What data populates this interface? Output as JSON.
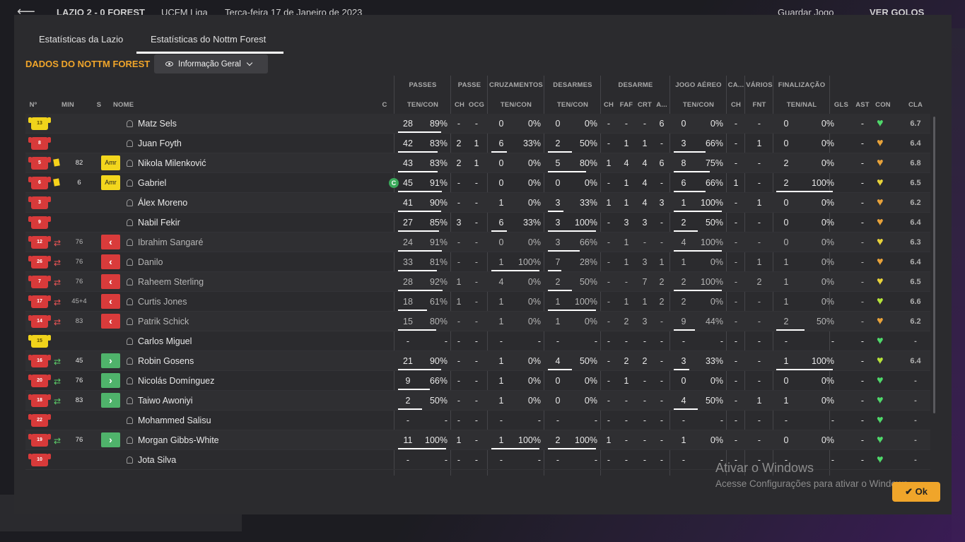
{
  "topbar": {
    "back": "⟵",
    "score": "LAZIO 2 - 0 FOREST",
    "competition": "UCFM Liga",
    "date": "Terça-feira 17 de Janeiro de 2023",
    "save": "Guardar Jogo",
    "goals": "VER GOLOS"
  },
  "tabs": [
    "Estatísticas da Lazio",
    "Estatísticas do Nottm Forest"
  ],
  "title": "DADOS DO NOTTM FOREST",
  "dropdown": "Informação Geral",
  "group_headers": [
    "PASSES",
    "PASSE",
    "CRUZAMENTOS",
    "DESARMES",
    "DESARME",
    "JOGO AÉREO",
    "CA...",
    "VÁRIOS",
    "FINALIZAÇÃO"
  ],
  "col_headers": [
    "Nº",
    "MIN",
    "S",
    "NOME",
    "C",
    "TEN/CON",
    "CH",
    "OCG",
    "TEN/CON",
    "TEN/CON",
    "CH",
    "FAF",
    "CRT",
    "A...",
    "TEN/CON",
    "CH",
    "FNT",
    "TEN/NAL",
    "GLS",
    "AST",
    "CON",
    "CLA"
  ],
  "players": [
    {
      "no": "13",
      "kit": "yel",
      "card": "",
      "sub": "",
      "min": "",
      "pos": "",
      "name": "Matz Sels",
      "cap": "",
      "pass": [
        "28",
        "89%"
      ],
      "passe": [
        "-",
        "-"
      ],
      "cruz": [
        "0",
        "0%"
      ],
      "des": [
        "0",
        "0%"
      ],
      "desarme": [
        "-",
        "-",
        "-",
        "6"
      ],
      "aereo": [
        "0",
        "0%"
      ],
      "ca": "-",
      "var": "-",
      "fin": [
        "0",
        "0%"
      ],
      "gls": "",
      "ast": "-",
      "con": "green",
      "cla": "6.7"
    },
    {
      "no": "8",
      "kit": "red",
      "card": "",
      "sub": "",
      "min": "",
      "pos": "",
      "name": "Juan Foyth",
      "cap": "",
      "pass": [
        "42",
        "83%"
      ],
      "passe": [
        "2",
        "1"
      ],
      "cruz": [
        "6",
        "33%"
      ],
      "des": [
        "2",
        "50%"
      ],
      "desarme": [
        "-",
        "1",
        "1",
        "-"
      ],
      "aereo": [
        "3",
        "66%"
      ],
      "ca": "-",
      "var": "1",
      "fin": [
        "0",
        "0%"
      ],
      "gls": "",
      "ast": "-",
      "con": "orange",
      "cla": "6.4"
    },
    {
      "no": "5",
      "kit": "red",
      "card": "y",
      "sub": "",
      "min": "82",
      "pos": "Amr",
      "name": "Nikola Milenković",
      "cap": "",
      "pass": [
        "43",
        "83%"
      ],
      "passe": [
        "2",
        "1"
      ],
      "cruz": [
        "0",
        "0%"
      ],
      "des": [
        "5",
        "80%"
      ],
      "desarme": [
        "1",
        "4",
        "4",
        "6"
      ],
      "aereo": [
        "8",
        "75%"
      ],
      "ca": "-",
      "var": "-",
      "fin": [
        "2",
        "0%"
      ],
      "gls": "",
      "ast": "-",
      "con": "orange",
      "cla": "6.8"
    },
    {
      "no": "6",
      "kit": "red",
      "card": "y",
      "sub": "",
      "min": "6",
      "pos": "Amr",
      "name": "Gabriel",
      "cap": "C",
      "pass": [
        "45",
        "91%"
      ],
      "passe": [
        "-",
        "-"
      ],
      "cruz": [
        "0",
        "0%"
      ],
      "des": [
        "0",
        "0%"
      ],
      "desarme": [
        "-",
        "1",
        "4",
        "-"
      ],
      "aereo": [
        "6",
        "66%"
      ],
      "ca": "1",
      "var": "-",
      "fin": [
        "2",
        "100%"
      ],
      "gls": "",
      "ast": "-",
      "con": "yellow",
      "cla": "6.5"
    },
    {
      "no": "3",
      "kit": "red",
      "card": "",
      "sub": "",
      "min": "",
      "pos": "",
      "name": "Álex Moreno",
      "cap": "",
      "pass": [
        "41",
        "90%"
      ],
      "passe": [
        "-",
        "-"
      ],
      "cruz": [
        "1",
        "0%"
      ],
      "des": [
        "3",
        "33%"
      ],
      "desarme": [
        "1",
        "1",
        "4",
        "3"
      ],
      "aereo": [
        "1",
        "100%"
      ],
      "ca": "-",
      "var": "1",
      "fin": [
        "0",
        "0%"
      ],
      "gls": "",
      "ast": "-",
      "con": "orange",
      "cla": "6.2"
    },
    {
      "no": "9",
      "kit": "red",
      "card": "",
      "sub": "",
      "min": "",
      "pos": "",
      "name": "Nabil Fekir",
      "cap": "",
      "pass": [
        "27",
        "85%"
      ],
      "passe": [
        "3",
        "-"
      ],
      "cruz": [
        "6",
        "33%"
      ],
      "des": [
        "3",
        "100%"
      ],
      "desarme": [
        "-",
        "3",
        "3",
        "-"
      ],
      "aereo": [
        "2",
        "50%"
      ],
      "ca": "-",
      "var": "-",
      "fin": [
        "0",
        "0%"
      ],
      "gls": "",
      "ast": "-",
      "con": "orange",
      "cla": "6.4"
    },
    {
      "no": "12",
      "kit": "red",
      "card": "",
      "sub": "out",
      "min": "76",
      "pos": "out",
      "name": "Ibrahim Sangaré",
      "cap": "",
      "pass": [
        "24",
        "91%"
      ],
      "passe": [
        "-",
        "-"
      ],
      "cruz": [
        "0",
        "0%"
      ],
      "des": [
        "3",
        "66%"
      ],
      "desarme": [
        "-",
        "1",
        "-",
        "-"
      ],
      "aereo": [
        "4",
        "100%"
      ],
      "ca": "-",
      "var": "-",
      "fin": [
        "0",
        "0%"
      ],
      "gls": "",
      "ast": "-",
      "con": "yellow",
      "cla": "6.3"
    },
    {
      "no": "26",
      "kit": "red",
      "card": "",
      "sub": "out",
      "min": "76",
      "pos": "out",
      "name": "Danilo",
      "cap": "",
      "pass": [
        "33",
        "81%"
      ],
      "passe": [
        "-",
        "-"
      ],
      "cruz": [
        "1",
        "100%"
      ],
      "des": [
        "7",
        "28%"
      ],
      "desarme": [
        "-",
        "1",
        "3",
        "1"
      ],
      "aereo": [
        "1",
        "0%"
      ],
      "ca": "-",
      "var": "1",
      "fin": [
        "1",
        "0%"
      ],
      "gls": "",
      "ast": "-",
      "con": "orange",
      "cla": "6.4"
    },
    {
      "no": "7",
      "kit": "red",
      "card": "",
      "sub": "out",
      "min": "76",
      "pos": "out",
      "name": "Raheem Sterling",
      "cap": "",
      "pass": [
        "28",
        "92%"
      ],
      "passe": [
        "1",
        "-"
      ],
      "cruz": [
        "4",
        "0%"
      ],
      "des": [
        "2",
        "50%"
      ],
      "desarme": [
        "-",
        "-",
        "7",
        "2"
      ],
      "aereo": [
        "2",
        "100%"
      ],
      "ca": "-",
      "var": "2",
      "fin": [
        "1",
        "0%"
      ],
      "gls": "",
      "ast": "-",
      "con": "yellow",
      "cla": "6.5"
    },
    {
      "no": "17",
      "kit": "red",
      "card": "",
      "sub": "out",
      "min": "45+4",
      "pos": "out",
      "name": "Curtis Jones",
      "cap": "",
      "pass": [
        "18",
        "61%"
      ],
      "passe": [
        "1",
        "-"
      ],
      "cruz": [
        "1",
        "0%"
      ],
      "des": [
        "1",
        "100%"
      ],
      "desarme": [
        "-",
        "1",
        "1",
        "2"
      ],
      "aereo": [
        "2",
        "0%"
      ],
      "ca": "-",
      "var": "-",
      "fin": [
        "1",
        "0%"
      ],
      "gls": "",
      "ast": "-",
      "con": "lime",
      "cla": "6.6"
    },
    {
      "no": "14",
      "kit": "red",
      "card": "",
      "sub": "out",
      "min": "83",
      "pos": "out",
      "name": "Patrik Schick",
      "cap": "",
      "pass": [
        "15",
        "80%"
      ],
      "passe": [
        "-",
        "-"
      ],
      "cruz": [
        "1",
        "0%"
      ],
      "des": [
        "1",
        "0%"
      ],
      "desarme": [
        "-",
        "2",
        "3",
        "-"
      ],
      "aereo": [
        "9",
        "44%"
      ],
      "ca": "-",
      "var": "-",
      "fin": [
        "2",
        "50%"
      ],
      "gls": "",
      "ast": "-",
      "con": "orange",
      "cla": "6.2"
    },
    {
      "no": "15",
      "kit": "yel",
      "card": "",
      "sub": "",
      "min": "",
      "pos": "",
      "name": "Carlos Miguel",
      "cap": "",
      "pass": [
        "-",
        "-"
      ],
      "passe": [
        "-",
        "-"
      ],
      "cruz": [
        "-",
        "-"
      ],
      "des": [
        "-",
        "-"
      ],
      "desarme": [
        "-",
        "-",
        "-",
        "-"
      ],
      "aereo": [
        "-",
        "-"
      ],
      "ca": "-",
      "var": "-",
      "fin": [
        "-",
        "-"
      ],
      "gls": "",
      "ast": "-",
      "con": "green",
      "cla": "-"
    },
    {
      "no": "16",
      "kit": "red",
      "card": "",
      "sub": "in",
      "min": "45",
      "pos": "in",
      "name": "Robin Gosens",
      "cap": "",
      "pass": [
        "21",
        "90%"
      ],
      "passe": [
        "-",
        "-"
      ],
      "cruz": [
        "1",
        "0%"
      ],
      "des": [
        "4",
        "50%"
      ],
      "desarme": [
        "-",
        "2",
        "2",
        "-"
      ],
      "aereo": [
        "3",
        "33%"
      ],
      "ca": "-",
      "var": "-",
      "fin": [
        "1",
        "100%"
      ],
      "gls": "",
      "ast": "-",
      "con": "lime",
      "cla": "6.4"
    },
    {
      "no": "20",
      "kit": "red",
      "card": "",
      "sub": "in",
      "min": "76",
      "pos": "in",
      "name": "Nicolás Domínguez",
      "cap": "",
      "pass": [
        "9",
        "66%"
      ],
      "passe": [
        "-",
        "-"
      ],
      "cruz": [
        "1",
        "0%"
      ],
      "des": [
        "0",
        "0%"
      ],
      "desarme": [
        "-",
        "1",
        "-",
        "-"
      ],
      "aereo": [
        "0",
        "0%"
      ],
      "ca": "-",
      "var": "-",
      "fin": [
        "0",
        "0%"
      ],
      "gls": "",
      "ast": "-",
      "con": "green",
      "cla": "-"
    },
    {
      "no": "18",
      "kit": "red",
      "card": "",
      "sub": "in",
      "min": "83",
      "pos": "in",
      "name": "Taiwo Awoniyi",
      "cap": "",
      "pass": [
        "2",
        "50%"
      ],
      "passe": [
        "-",
        "-"
      ],
      "cruz": [
        "1",
        "0%"
      ],
      "des": [
        "0",
        "0%"
      ],
      "desarme": [
        "-",
        "-",
        "-",
        "-"
      ],
      "aereo": [
        "4",
        "50%"
      ],
      "ca": "-",
      "var": "1",
      "fin": [
        "1",
        "0%"
      ],
      "gls": "",
      "ast": "-",
      "con": "green",
      "cla": "-"
    },
    {
      "no": "22",
      "kit": "red",
      "card": "",
      "sub": "",
      "min": "",
      "pos": "",
      "name": "Mohammed Salisu",
      "cap": "",
      "pass": [
        "-",
        "-"
      ],
      "passe": [
        "-",
        "-"
      ],
      "cruz": [
        "-",
        "-"
      ],
      "des": [
        "-",
        "-"
      ],
      "desarme": [
        "-",
        "-",
        "-",
        "-"
      ],
      "aereo": [
        "-",
        "-"
      ],
      "ca": "-",
      "var": "-",
      "fin": [
        "-",
        "-"
      ],
      "gls": "",
      "ast": "-",
      "con": "green",
      "cla": "-"
    },
    {
      "no": "19",
      "kit": "red",
      "card": "",
      "sub": "in",
      "min": "76",
      "pos": "in",
      "name": "Morgan Gibbs-White",
      "cap": "",
      "pass": [
        "11",
        "100%"
      ],
      "passe": [
        "1",
        "-"
      ],
      "cruz": [
        "1",
        "100%"
      ],
      "des": [
        "2",
        "100%"
      ],
      "desarme": [
        "1",
        "-",
        "-",
        "-"
      ],
      "aereo": [
        "1",
        "0%"
      ],
      "ca": "-",
      "var": "-",
      "fin": [
        "0",
        "0%"
      ],
      "gls": "",
      "ast": "-",
      "con": "green",
      "cla": "-"
    },
    {
      "no": "10",
      "kit": "red",
      "card": "",
      "sub": "",
      "min": "",
      "pos": "",
      "name": "Jota Silva",
      "cap": "",
      "pass": [
        "-",
        "-"
      ],
      "passe": [
        "-",
        "-"
      ],
      "cruz": [
        "-",
        "-"
      ],
      "des": [
        "-",
        "-"
      ],
      "desarme": [
        "-",
        "-",
        "-",
        "-"
      ],
      "aereo": [
        "-",
        "-"
      ],
      "ca": "-",
      "var": "-",
      "fin": [
        "-",
        "-"
      ],
      "gls": "",
      "ast": "-",
      "con": "green",
      "cla": "-"
    }
  ],
  "watermark": {
    "line1": "Ativar o Windows",
    "line2": "Acesse Configurações para ativar o Windows."
  },
  "ok": "Ok",
  "colors": {
    "accent": "#f0a52a",
    "green": "#4fd86a",
    "lime": "#b5e23a",
    "yellow": "#e8d23a",
    "orange": "#e7a23a"
  }
}
